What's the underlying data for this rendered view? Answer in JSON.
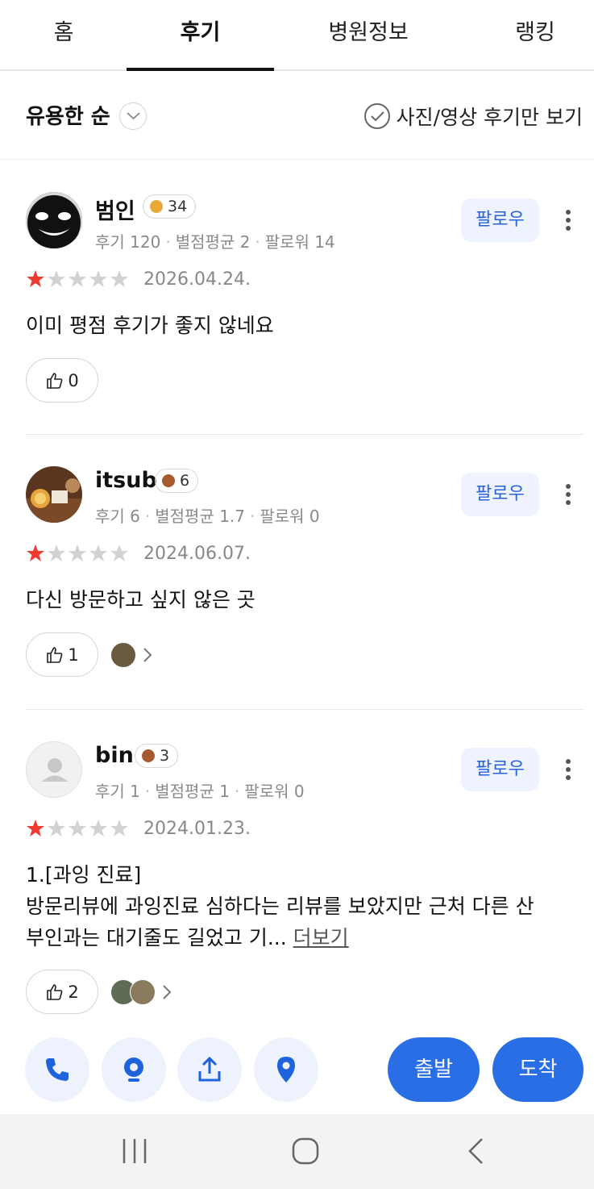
{
  "tabs": [
    {
      "label": "홈",
      "active": false
    },
    {
      "label": "후기",
      "active": true
    },
    {
      "label": "병원정보",
      "active": false
    },
    {
      "label": "랭킹",
      "active": false
    }
  ],
  "sort": {
    "label": "유용한 순",
    "photo_filter_label": "사진/영상 후기만 보기"
  },
  "reviews": [
    {
      "name": "범인",
      "badge_icon": "gold-level-badge-icon",
      "badge_count": "34",
      "stats": {
        "reviews": "후기 120",
        "avg": "별점평균 2",
        "followers": "팔로워 14"
      },
      "follow_label": "팔로우",
      "rating": 1,
      "date": "2026.04.24.",
      "text": "이미 평점 후기가 좋지 않네요",
      "likes": "0",
      "photos": 0
    },
    {
      "name": "itsub",
      "badge_icon": "bronze-level-badge-icon",
      "badge_count": "6",
      "stats": {
        "reviews": "후기 6",
        "avg": "별점평균 1.7",
        "followers": "팔로워 0"
      },
      "follow_label": "팔로우",
      "rating": 1,
      "date": "2024.06.07.",
      "text": "다신 방문하고 싶지 않은 곳",
      "likes": "1",
      "photos": 1
    },
    {
      "name": "bin",
      "badge_icon": "bronze-level-badge-icon",
      "badge_count": "3",
      "stats": {
        "reviews": "후기 1",
        "avg": "별점평균 1",
        "followers": "팔로워 0"
      },
      "follow_label": "팔로우",
      "rating": 1,
      "date": "2024.01.23.",
      "text_line1": "1.[과잉 진료]",
      "text_line2": "방문리뷰에 과잉진료 심하다는 리뷰를 보았지만 근처 다른 산",
      "text_line3": "부인과는 대기줄도 길었고 기...",
      "more_label": "더보기",
      "likes": "2",
      "photos": 2
    }
  ],
  "actions": {
    "icons": [
      "phone-icon",
      "navigation-icon",
      "share-icon",
      "location-pin-icon"
    ],
    "depart_label": "출발",
    "arrive_label": "도착"
  },
  "colors": {
    "accent": "#2a6ee6",
    "star_active": "#ee3a2f",
    "star_inactive": "#d2d2d2",
    "follow_bg": "#eef3ff"
  }
}
